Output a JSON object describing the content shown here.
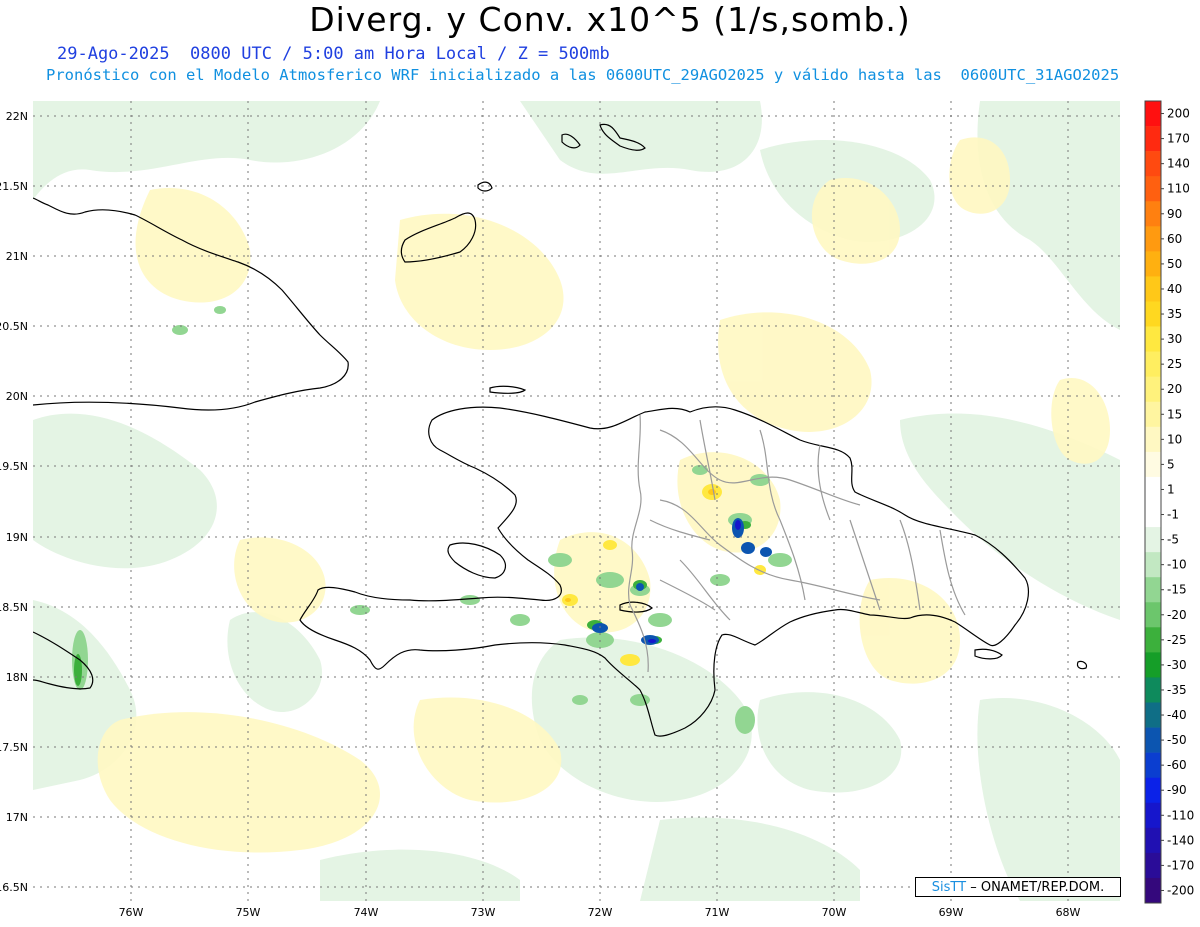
{
  "header": {
    "title": "Diverg. y Conv. x10^5 (1/s,somb.)",
    "line1": "29-Ago-2025  0800 UTC / 5:00 am Hora Local / Z = 500mb",
    "line2": "Pronóstico con el Modelo Atmosferico WRF inicializado a las 0600UTC_29AGO2025 y válido hasta las  0600UTC_31AGO2025"
  },
  "map": {
    "lat_labels": [
      "22N",
      "21.5N",
      "21N",
      "20.5N",
      "20N",
      "19.5N",
      "19N",
      "18.5N",
      "18N",
      "17.5N",
      "17N",
      "16.5N"
    ],
    "lon_labels": [
      "76W",
      "75W",
      "74W",
      "73W",
      "72W",
      "71W",
      "70W",
      "69W",
      "68W"
    ]
  },
  "colorbar": {
    "labels": [
      "200",
      "170",
      "140",
      "110",
      "90",
      "60",
      "50",
      "40",
      "35",
      "30",
      "25",
      "20",
      "15",
      "10",
      "5",
      "1",
      "-1",
      "-5",
      "-10",
      "-15",
      "-20",
      "-25",
      "-30",
      "-35",
      "-40",
      "-50",
      "-60",
      "-90",
      "-110",
      "-140",
      "-170",
      "-200"
    ],
    "colors": [
      "#ff1010",
      "#ff2a10",
      "#ff4a10",
      "#ff6010",
      "#ff8010",
      "#ff9a10",
      "#ffb010",
      "#ffc818",
      "#ffd820",
      "#ffe840",
      "#ffee60",
      "#fff27c",
      "#fff5a0",
      "#fff8c2",
      "#fffbe2",
      "#ffffff",
      "#ffffff",
      "#e4f4e4",
      "#c2e8c2",
      "#92d692",
      "#6cc66c",
      "#3cb03c",
      "#159e28",
      "#0e8a5c",
      "#0f6e86",
      "#0c55b0",
      "#0b3ed0",
      "#0b22e8",
      "#1616cc",
      "#2010b2",
      "#2a0c98",
      "#34087c"
    ]
  },
  "credit": {
    "logo": "SisTT",
    "text": "– ONAMET/REP.DOM."
  }
}
